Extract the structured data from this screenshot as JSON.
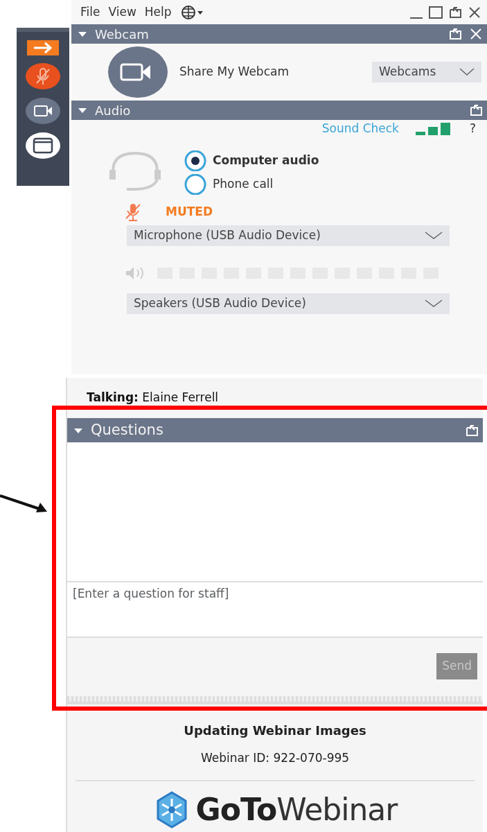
{
  "menu": [
    {
      "label": "File"
    },
    {
      "label": "View"
    },
    {
      "label": "Help"
    }
  ],
  "side_toolbar": {
    "muted": true
  },
  "webcam_panel": {
    "title": "Webcam",
    "share_label": "Share My Webcam",
    "dropdown": "Webcams"
  },
  "audio_panel": {
    "title": "Audio",
    "sound_check": "Sound Check",
    "help": "?",
    "options": [
      {
        "label": "Computer audio",
        "selected": true
      },
      {
        "label": "Phone call",
        "selected": false
      }
    ],
    "muted": true,
    "muted_label": "MUTED",
    "microphone": "Microphone (USB Audio Device)",
    "speakers": "Speakers (USB Audio Device)"
  },
  "talking": {
    "label": "Talking:",
    "name": "Elaine Ferrell"
  },
  "questions_panel": {
    "title": "Questions",
    "placeholder": "[Enter a question for staff]",
    "send": "Send",
    "send_disabled": true
  },
  "footer": {
    "title": "Updating Webinar Images",
    "webinar_id": "Webinar ID: 922-070-995",
    "logo": "**GoTo**Webinar"
  }
}
